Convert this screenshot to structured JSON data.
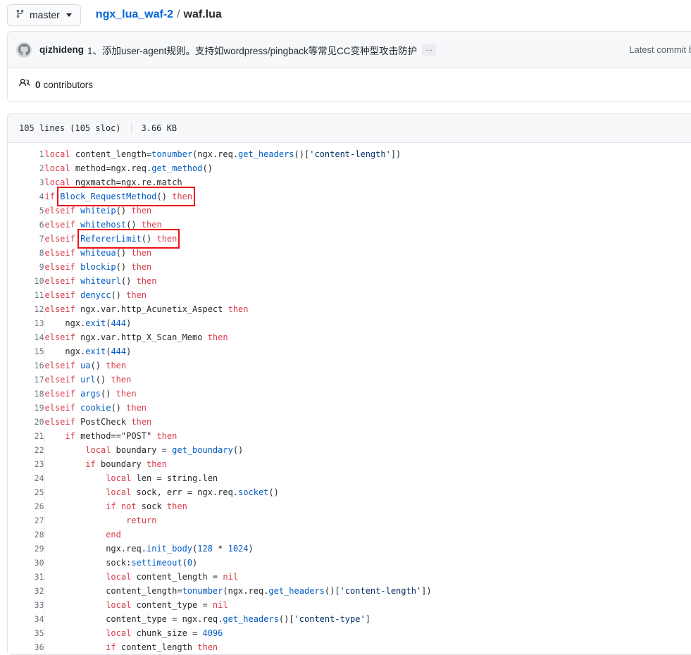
{
  "topbar": {
    "branch": {
      "icon": "branch-icon",
      "label": "master",
      "caret": "chevron-down-icon"
    },
    "breadcrumb": {
      "repo": "ngx_lua_waf-2",
      "separator": "/",
      "file": "waf.lua"
    }
  },
  "commit": {
    "avatar_icon": "octocat-avatar-icon",
    "author": "qizhideng",
    "message": "1、添加user-agent规则。支持如wordpress/pingback等常见CC变种型攻击防护",
    "expand_label": "…",
    "latest_commit": "Latest commit b"
  },
  "contributors": {
    "icon": "people-icon",
    "count": "0",
    "label": "contributors"
  },
  "blob": {
    "lines_label": "105 lines (105 sloc)",
    "size_label": "3.66 KB"
  },
  "code": {
    "language": "lua",
    "lines": [
      {
        "n": 1,
        "tokens": [
          {
            "t": "local",
            "c": "k"
          },
          {
            "t": " content_length=",
            "c": "p"
          },
          {
            "t": "tonumber",
            "c": "fn"
          },
          {
            "t": "(ngx.req.",
            "c": "p"
          },
          {
            "t": "get_headers",
            "c": "fn"
          },
          {
            "t": "()[",
            "c": "p"
          },
          {
            "t": "'content-length'",
            "c": "s"
          },
          {
            "t": "])",
            "c": "p"
          }
        ]
      },
      {
        "n": 2,
        "tokens": [
          {
            "t": "local",
            "c": "k"
          },
          {
            "t": " method=ngx.req.",
            "c": "p"
          },
          {
            "t": "get_method",
            "c": "fn"
          },
          {
            "t": "()",
            "c": "p"
          }
        ]
      },
      {
        "n": 3,
        "tokens": [
          {
            "t": "local",
            "c": "k"
          },
          {
            "t": " ngxmatch=ngx.re.match",
            "c": "p"
          }
        ]
      },
      {
        "n": 4,
        "box": true,
        "boxstart": 1,
        "tokens": [
          {
            "t": "if ",
            "c": "k"
          },
          {
            "t": "Block_RequestMethod",
            "c": "fn"
          },
          {
            "t": "() ",
            "c": "p"
          },
          {
            "t": "then",
            "c": "k"
          }
        ]
      },
      {
        "n": 5,
        "tokens": [
          {
            "t": "elseif ",
            "c": "k"
          },
          {
            "t": "whiteip",
            "c": "fn"
          },
          {
            "t": "() ",
            "c": "p"
          },
          {
            "t": "then",
            "c": "k"
          }
        ]
      },
      {
        "n": 6,
        "tokens": [
          {
            "t": "elseif ",
            "c": "k"
          },
          {
            "t": "whitehost",
            "c": "fn"
          },
          {
            "t": "() ",
            "c": "p"
          },
          {
            "t": "then",
            "c": "k"
          }
        ]
      },
      {
        "n": 7,
        "box": true,
        "boxstart": 1,
        "tokens": [
          {
            "t": "elseif ",
            "c": "k"
          },
          {
            "t": "RefererLimit",
            "c": "fn"
          },
          {
            "t": "() ",
            "c": "p"
          },
          {
            "t": "then",
            "c": "k"
          }
        ]
      },
      {
        "n": 8,
        "tokens": [
          {
            "t": "elseif ",
            "c": "k"
          },
          {
            "t": "whiteua",
            "c": "fn"
          },
          {
            "t": "() ",
            "c": "p"
          },
          {
            "t": "then",
            "c": "k"
          }
        ]
      },
      {
        "n": 9,
        "tokens": [
          {
            "t": "elseif ",
            "c": "k"
          },
          {
            "t": "blockip",
            "c": "fn"
          },
          {
            "t": "() ",
            "c": "p"
          },
          {
            "t": "then",
            "c": "k"
          }
        ]
      },
      {
        "n": 10,
        "tokens": [
          {
            "t": "elseif ",
            "c": "k"
          },
          {
            "t": "whiteurl",
            "c": "fn"
          },
          {
            "t": "() ",
            "c": "p"
          },
          {
            "t": "then",
            "c": "k"
          }
        ]
      },
      {
        "n": 11,
        "tokens": [
          {
            "t": "elseif ",
            "c": "k"
          },
          {
            "t": "denycc",
            "c": "fn"
          },
          {
            "t": "() ",
            "c": "p"
          },
          {
            "t": "then",
            "c": "k"
          }
        ]
      },
      {
        "n": 12,
        "tokens": [
          {
            "t": "elseif ",
            "c": "k"
          },
          {
            "t": "ngx.var.http_Acunetix_Aspect ",
            "c": "p"
          },
          {
            "t": "then",
            "c": "k"
          }
        ]
      },
      {
        "n": 13,
        "tokens": [
          {
            "t": "    ngx.",
            "c": "p"
          },
          {
            "t": "exit",
            "c": "fn"
          },
          {
            "t": "(",
            "c": "p"
          },
          {
            "t": "444",
            "c": "n"
          },
          {
            "t": ")",
            "c": "p"
          }
        ]
      },
      {
        "n": 14,
        "tokens": [
          {
            "t": "elseif ",
            "c": "k"
          },
          {
            "t": "ngx.var.http_X_Scan_Memo ",
            "c": "p"
          },
          {
            "t": "then",
            "c": "k"
          }
        ]
      },
      {
        "n": 15,
        "tokens": [
          {
            "t": "    ngx.",
            "c": "p"
          },
          {
            "t": "exit",
            "c": "fn"
          },
          {
            "t": "(",
            "c": "p"
          },
          {
            "t": "444",
            "c": "n"
          },
          {
            "t": ")",
            "c": "p"
          }
        ]
      },
      {
        "n": 16,
        "tokens": [
          {
            "t": "elseif ",
            "c": "k"
          },
          {
            "t": "ua",
            "c": "fn"
          },
          {
            "t": "() ",
            "c": "p"
          },
          {
            "t": "then",
            "c": "k"
          }
        ]
      },
      {
        "n": 17,
        "tokens": [
          {
            "t": "elseif ",
            "c": "k"
          },
          {
            "t": "url",
            "c": "fn"
          },
          {
            "t": "() ",
            "c": "p"
          },
          {
            "t": "then",
            "c": "k"
          }
        ]
      },
      {
        "n": 18,
        "tokens": [
          {
            "t": "elseif ",
            "c": "k"
          },
          {
            "t": "args",
            "c": "fn"
          },
          {
            "t": "() ",
            "c": "p"
          },
          {
            "t": "then",
            "c": "k"
          }
        ]
      },
      {
        "n": 19,
        "tokens": [
          {
            "t": "elseif ",
            "c": "k"
          },
          {
            "t": "cookie",
            "c": "fn"
          },
          {
            "t": "() ",
            "c": "p"
          },
          {
            "t": "then",
            "c": "k"
          }
        ]
      },
      {
        "n": 20,
        "tokens": [
          {
            "t": "elseif ",
            "c": "k"
          },
          {
            "t": "PostCheck ",
            "c": "p"
          },
          {
            "t": "then",
            "c": "k"
          }
        ]
      },
      {
        "n": 21,
        "tokens": [
          {
            "t": "    ",
            "c": "p"
          },
          {
            "t": "if",
            "c": "k"
          },
          {
            "t": " method==\"POST\" ",
            "c": "p"
          },
          {
            "t": "then",
            "c": "k"
          }
        ]
      },
      {
        "n": 22,
        "tokens": [
          {
            "t": "        ",
            "c": "p"
          },
          {
            "t": "local",
            "c": "k"
          },
          {
            "t": " boundary = ",
            "c": "p"
          },
          {
            "t": "get_boundary",
            "c": "fn"
          },
          {
            "t": "()",
            "c": "p"
          }
        ]
      },
      {
        "n": 23,
        "tokens": [
          {
            "t": "        ",
            "c": "p"
          },
          {
            "t": "if",
            "c": "k"
          },
          {
            "t": " boundary ",
            "c": "p"
          },
          {
            "t": "then",
            "c": "k"
          }
        ]
      },
      {
        "n": 24,
        "tokens": [
          {
            "t": "            ",
            "c": "p"
          },
          {
            "t": "local",
            "c": "k"
          },
          {
            "t": " len = string.len",
            "c": "p"
          }
        ]
      },
      {
        "n": 25,
        "tokens": [
          {
            "t": "            ",
            "c": "p"
          },
          {
            "t": "local",
            "c": "k"
          },
          {
            "t": " sock, err = ngx.req.",
            "c": "p"
          },
          {
            "t": "socket",
            "c": "fn"
          },
          {
            "t": "()",
            "c": "p"
          }
        ]
      },
      {
        "n": 26,
        "tokens": [
          {
            "t": "            ",
            "c": "p"
          },
          {
            "t": "if not",
            "c": "k"
          },
          {
            "t": " sock ",
            "c": "p"
          },
          {
            "t": "then",
            "c": "k"
          }
        ]
      },
      {
        "n": 27,
        "tokens": [
          {
            "t": "                ",
            "c": "p"
          },
          {
            "t": "return",
            "c": "k"
          }
        ]
      },
      {
        "n": 28,
        "tokens": [
          {
            "t": "            ",
            "c": "p"
          },
          {
            "t": "end",
            "c": "k"
          }
        ]
      },
      {
        "n": 29,
        "tokens": [
          {
            "t": "            ngx.req.",
            "c": "p"
          },
          {
            "t": "init_body",
            "c": "fn"
          },
          {
            "t": "(",
            "c": "p"
          },
          {
            "t": "128",
            "c": "n"
          },
          {
            "t": " * ",
            "c": "p"
          },
          {
            "t": "1024",
            "c": "n"
          },
          {
            "t": ")",
            "c": "p"
          }
        ]
      },
      {
        "n": 30,
        "tokens": [
          {
            "t": "            sock:",
            "c": "p"
          },
          {
            "t": "settimeout",
            "c": "fn"
          },
          {
            "t": "(",
            "c": "p"
          },
          {
            "t": "0",
            "c": "n"
          },
          {
            "t": ")",
            "c": "p"
          }
        ]
      },
      {
        "n": 31,
        "tokens": [
          {
            "t": "            ",
            "c": "p"
          },
          {
            "t": "local",
            "c": "k"
          },
          {
            "t": " content_length = ",
            "c": "p"
          },
          {
            "t": "nil",
            "c": "k"
          }
        ]
      },
      {
        "n": 32,
        "tokens": [
          {
            "t": "            content_length=",
            "c": "p"
          },
          {
            "t": "tonumber",
            "c": "fn"
          },
          {
            "t": "(ngx.req.",
            "c": "p"
          },
          {
            "t": "get_headers",
            "c": "fn"
          },
          {
            "t": "()[",
            "c": "p"
          },
          {
            "t": "'content-length'",
            "c": "s"
          },
          {
            "t": "])",
            "c": "p"
          }
        ]
      },
      {
        "n": 33,
        "tokens": [
          {
            "t": "            ",
            "c": "p"
          },
          {
            "t": "local",
            "c": "k"
          },
          {
            "t": " content_type = ",
            "c": "p"
          },
          {
            "t": "nil",
            "c": "k"
          }
        ]
      },
      {
        "n": 34,
        "tokens": [
          {
            "t": "            content_type = ngx.req.",
            "c": "p"
          },
          {
            "t": "get_headers",
            "c": "fn"
          },
          {
            "t": "()[",
            "c": "p"
          },
          {
            "t": "'content-type'",
            "c": "s"
          },
          {
            "t": "]",
            "c": "p"
          }
        ]
      },
      {
        "n": 35,
        "tokens": [
          {
            "t": "            ",
            "c": "p"
          },
          {
            "t": "local",
            "c": "k"
          },
          {
            "t": " chunk_size = ",
            "c": "p"
          },
          {
            "t": "4096",
            "c": "n"
          }
        ]
      },
      {
        "n": 36,
        "tokens": [
          {
            "t": "            ",
            "c": "p"
          },
          {
            "t": "if",
            "c": "k"
          },
          {
            "t": " content_length ",
            "c": "p"
          },
          {
            "t": "then",
            "c": "k"
          }
        ]
      }
    ]
  },
  "colors": {
    "keyword": "#d73a49",
    "function": "#005cc5",
    "string": "#032f62",
    "plain": "#24292e",
    "link": "#0366d6",
    "highlight_box": "#ee1111",
    "panel_bg": "#f6f8fa",
    "border": "#e1e4e8"
  }
}
